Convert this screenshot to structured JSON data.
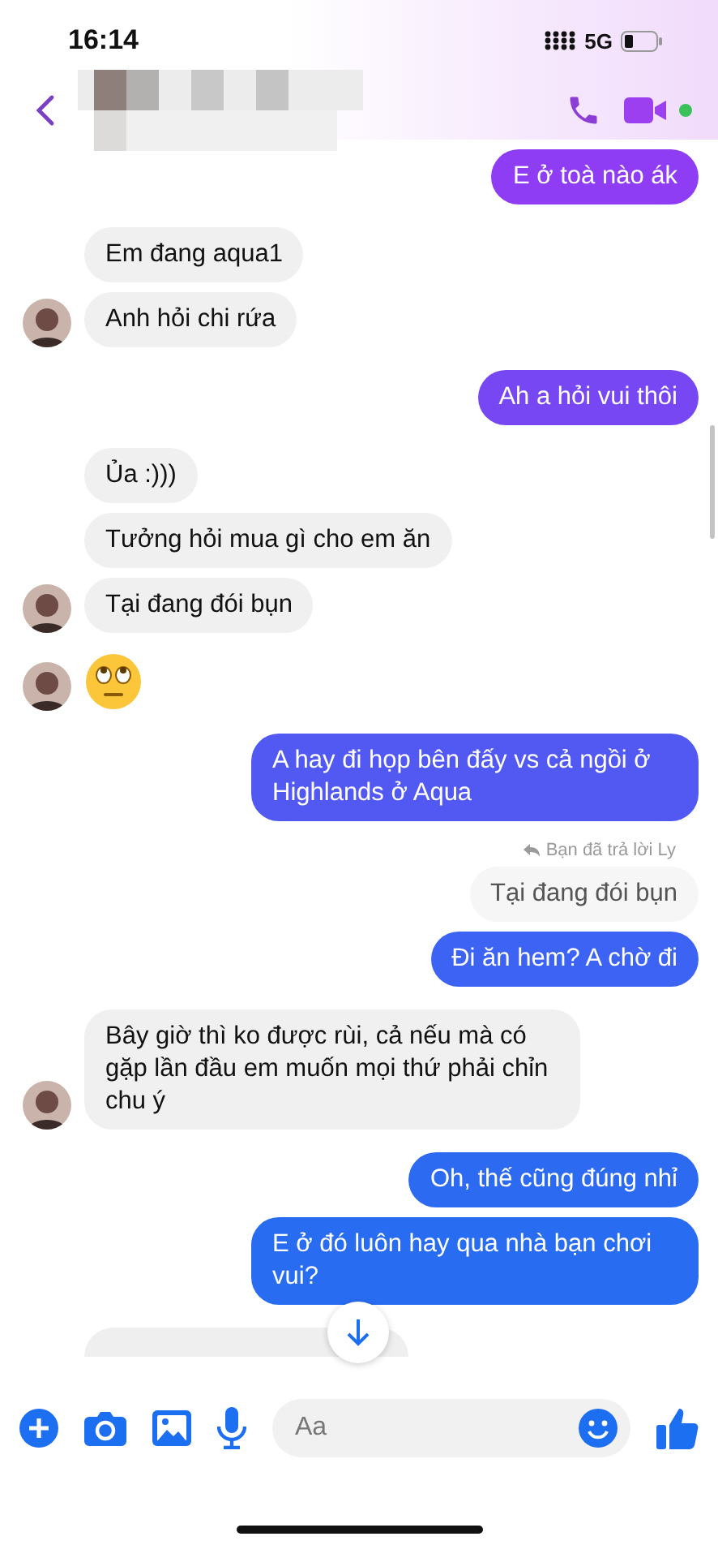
{
  "status_bar": {
    "time": "16:14",
    "network": "5G"
  },
  "header": {
    "online": true
  },
  "messages": [
    {
      "kind": "outgoing",
      "text": "E ở toà nào ák"
    },
    {
      "kind": "incoming",
      "text": "Em đang aqua1",
      "avatar": false
    },
    {
      "kind": "incoming",
      "text": "Anh hỏi chi rứa",
      "avatar": true
    },
    {
      "kind": "outgoing",
      "text": "Ah a hỏi vui thôi"
    },
    {
      "kind": "incoming",
      "text": "Ủa :)))",
      "avatar": false
    },
    {
      "kind": "incoming",
      "text": "Tưởng hỏi mua gì cho em ăn",
      "avatar": false
    },
    {
      "kind": "incoming",
      "text": "Tại đang đói bụn",
      "avatar": true
    },
    {
      "kind": "emoji",
      "avatar": true
    },
    {
      "kind": "outgoing",
      "text": "A hay đi họp bên đấy vs cả ngồi ở Highlands ở Aqua"
    },
    {
      "kind": "reply_note",
      "text": "Bạn đã trả lời Ly"
    },
    {
      "kind": "quoted",
      "text": "Tại đang đói bụn"
    },
    {
      "kind": "outgoing",
      "text": "Đi ăn hem? A chờ đi"
    },
    {
      "kind": "incoming",
      "text": "Bây giờ thì ko được rùi, cả nếu mà có gặp lần đầu em muốn mọi thứ phải chỉn chu ý",
      "avatar": true
    },
    {
      "kind": "outgoing",
      "text": "Oh, thế cũng đúng nhỉ"
    },
    {
      "kind": "outgoing",
      "text": "E ở đó luôn hay qua nhà bạn chơi vui?"
    },
    {
      "kind": "cut_off"
    }
  ],
  "composer": {
    "placeholder": "Aa"
  }
}
